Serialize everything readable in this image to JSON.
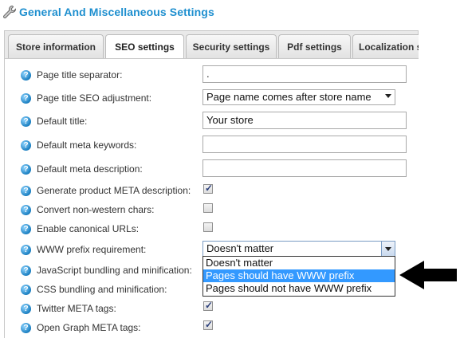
{
  "header": {
    "title": "General And Miscellaneous Settings",
    "icon": "wrench-icon"
  },
  "tabs": [
    {
      "label": "Store information",
      "active": false
    },
    {
      "label": "SEO settings",
      "active": true
    },
    {
      "label": "Security settings",
      "active": false
    },
    {
      "label": "Pdf settings",
      "active": false
    },
    {
      "label": "Localization settings",
      "active": false
    }
  ],
  "fields": {
    "page_title_separator": {
      "label": "Page title separator:",
      "value": "."
    },
    "page_title_seo_adjustment": {
      "label": "Page title SEO adjustment:",
      "value": "Page name comes after store name"
    },
    "default_title": {
      "label": "Default title:",
      "value": "Your store"
    },
    "default_meta_keywords": {
      "label": "Default meta keywords:",
      "value": ""
    },
    "default_meta_description": {
      "label": "Default meta description:",
      "value": ""
    },
    "generate_product_meta_description": {
      "label": "Generate product META description:",
      "checked": true
    },
    "convert_non_western_chars": {
      "label": "Convert non-western chars:",
      "checked": false
    },
    "enable_canonical_urls": {
      "label": "Enable canonical URLs:",
      "checked": false
    },
    "www_prefix_requirement": {
      "label": "WWW prefix requirement:",
      "value": "Doesn't matter",
      "options": [
        "Doesn't matter",
        "Pages should have WWW prefix",
        "Pages should not have WWW prefix"
      ],
      "highlighted_option": "Pages should have WWW prefix"
    },
    "javascript_bundling": {
      "label": "JavaScript bundling and minification:"
    },
    "css_bundling": {
      "label": "CSS bundling and minification:"
    },
    "twitter_meta_tags": {
      "label": "Twitter META tags:",
      "checked": true
    },
    "open_graph_meta_tags": {
      "label": "Open Graph META tags:",
      "checked": true
    }
  },
  "colors": {
    "title": "#1e8fcf",
    "highlight": "#3399ff"
  }
}
